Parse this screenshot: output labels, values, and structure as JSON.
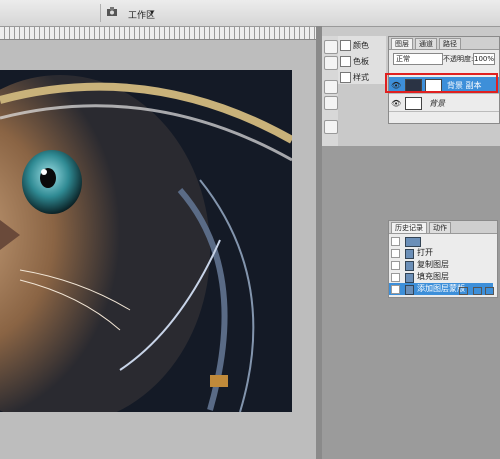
{
  "toolbar": {
    "workspace_label": "工作区",
    "workspace_arrow": "▾"
  },
  "mini_panel": {
    "items": [
      {
        "label": "颜色",
        "icon": "color-swatch-icon"
      },
      {
        "label": "色板",
        "icon": "swatches-icon"
      },
      {
        "label": "样式",
        "icon": "styles-icon"
      }
    ]
  },
  "layers_panel": {
    "tabs": [
      "图层",
      "通道",
      "路径"
    ],
    "blend_mode": "正常",
    "opacity_label": "不透明度:",
    "opacity_value": "100%",
    "layers": [
      {
        "name": "背景 副本",
        "selected": true
      },
      {
        "name": "背景",
        "selected": false
      }
    ]
  },
  "history_panel": {
    "tabs": [
      "历史记录",
      "动作"
    ],
    "items": [
      {
        "label": "打开",
        "selected": false
      },
      {
        "label": "复制图层",
        "selected": false
      },
      {
        "label": "填充图层",
        "selected": false
      },
      {
        "label": "添加图层蒙版",
        "selected": true
      }
    ]
  },
  "colors": {
    "accent": "#3d8fd9",
    "highlight_box": "#e02020"
  }
}
